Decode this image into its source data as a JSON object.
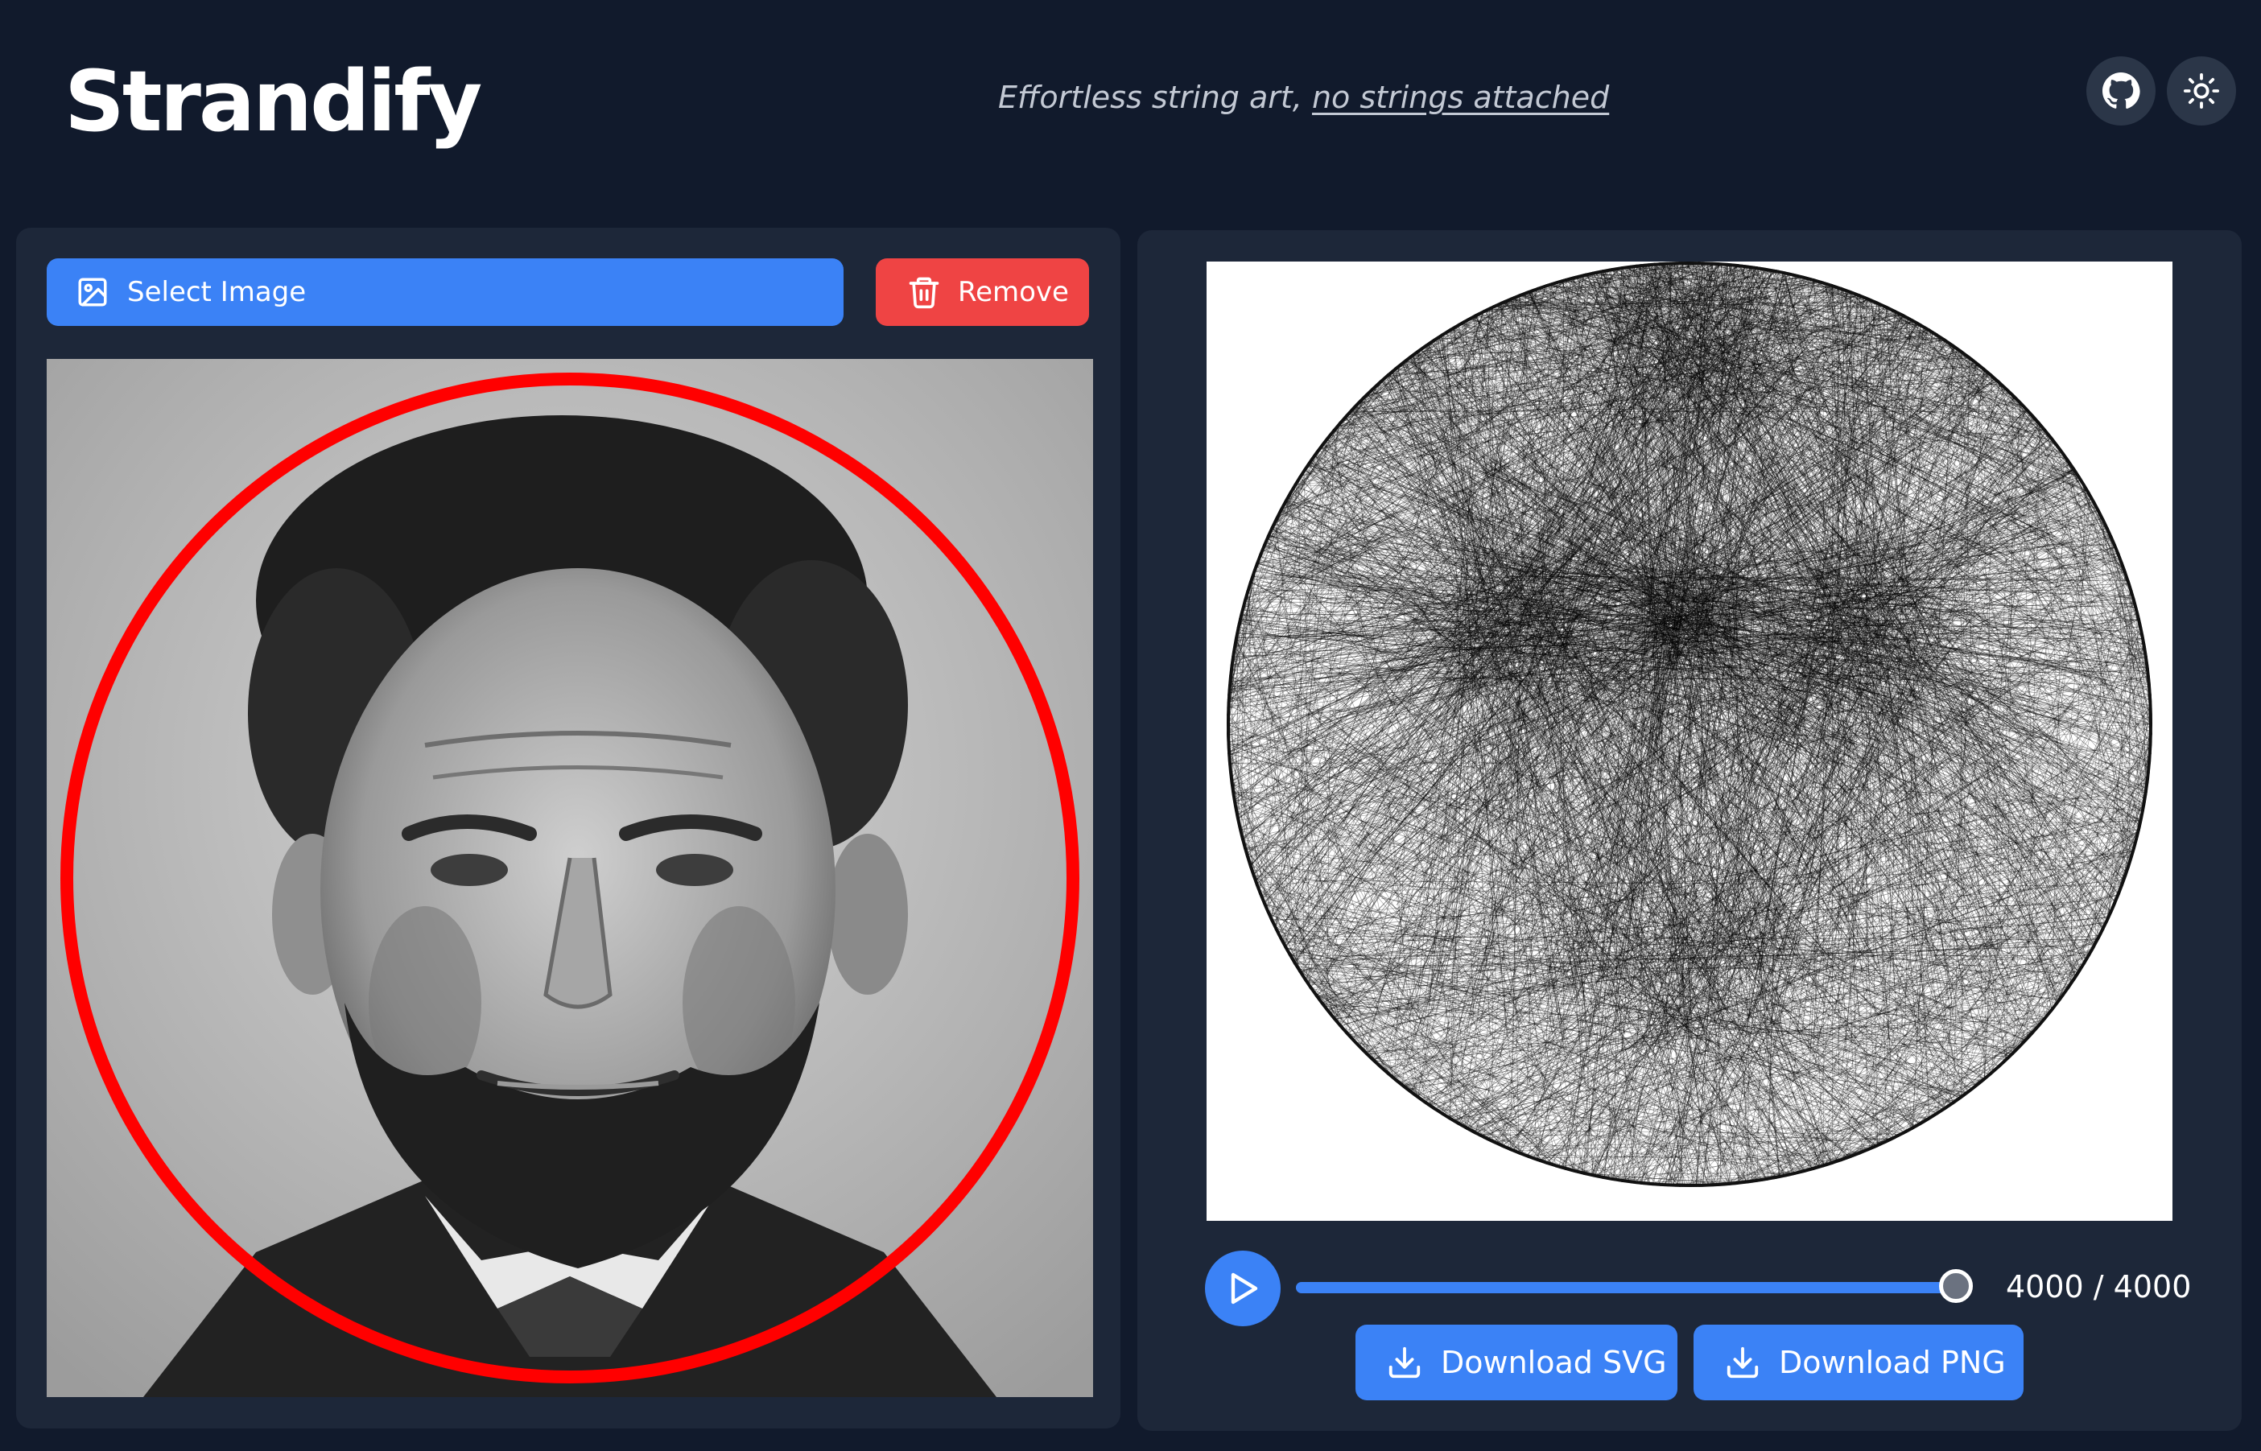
{
  "header": {
    "brand": "Strandify",
    "tagline_prefix": "Effortless string art,",
    "tagline_link": "no strings attached",
    "icons": [
      "github-icon",
      "sun-icon"
    ]
  },
  "left_panel": {
    "select_button_label": "Select Image",
    "remove_button_label": "Remove",
    "crop_circle_color": "#ff0000",
    "image_description_icon": "portrait-photo"
  },
  "right_panel": {
    "progress_label": "4000 / 4000",
    "progress_fraction": 1.0,
    "download_svg_label": "Download SVG",
    "download_png_label": "Download PNG"
  },
  "colors": {
    "background": "#111a2c",
    "panel": "#1d2739",
    "accent_blue": "#3b82f6",
    "danger_red": "#ef4444"
  }
}
